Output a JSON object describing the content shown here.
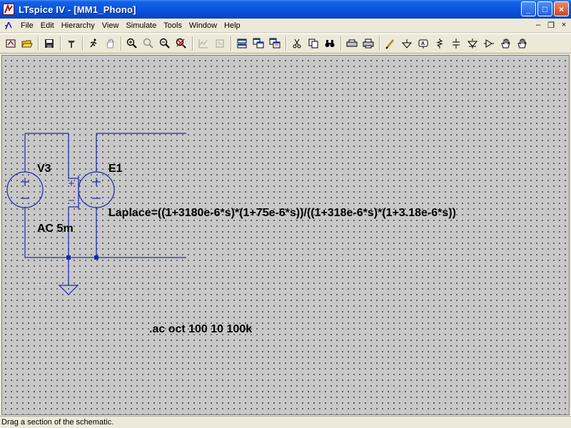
{
  "window": {
    "title": "LTspice IV - [MM1_Phono]",
    "minimize": "_",
    "maximize": "□",
    "close": "×"
  },
  "menu": {
    "items": [
      {
        "label": "File"
      },
      {
        "label": "Edit"
      },
      {
        "label": "Hierarchy"
      },
      {
        "label": "View"
      },
      {
        "label": "Simulate"
      },
      {
        "label": "Tools"
      },
      {
        "label": "Window"
      },
      {
        "label": "Help"
      }
    ],
    "mdi_minimize": "–",
    "mdi_restore": "❐",
    "mdi_close": "×"
  },
  "toolbar": {
    "icons": [
      "new-schematic-icon",
      "open-icon",
      "save-icon",
      "control-panel-icon",
      "run-icon",
      "halt-icon",
      "zoom-in-icon",
      "pan-icon",
      "zoom-out-icon",
      "zoom-cancel-icon",
      "autorange-icon",
      "fit-icon",
      "tile-horizontal-icon",
      "cascade-icon",
      "tile-vertical-icon",
      "cut-icon",
      "copy-icon",
      "find-icon",
      "print-setup-icon",
      "print-icon",
      "wire-icon",
      "ground-icon",
      "label-net-icon",
      "resistor-icon",
      "capacitor-icon",
      "diode-icon",
      "component-icon",
      "move-icon",
      "drag-icon"
    ]
  },
  "schematic": {
    "source_name": "V3",
    "source_value": "AC 5m",
    "controlled_source_name": "E1",
    "laplace_expr": "Laplace=((1+3180e-6*s)*(1+75e-6*s))/((1+318e-6*s)*(1+3.18e-6*s))",
    "directive": ".ac oct 100 10 100k",
    "wire_color": "#1e28b4",
    "junction_color": "#1e28b4"
  },
  "status": {
    "text": "Drag a section of the schematic."
  }
}
